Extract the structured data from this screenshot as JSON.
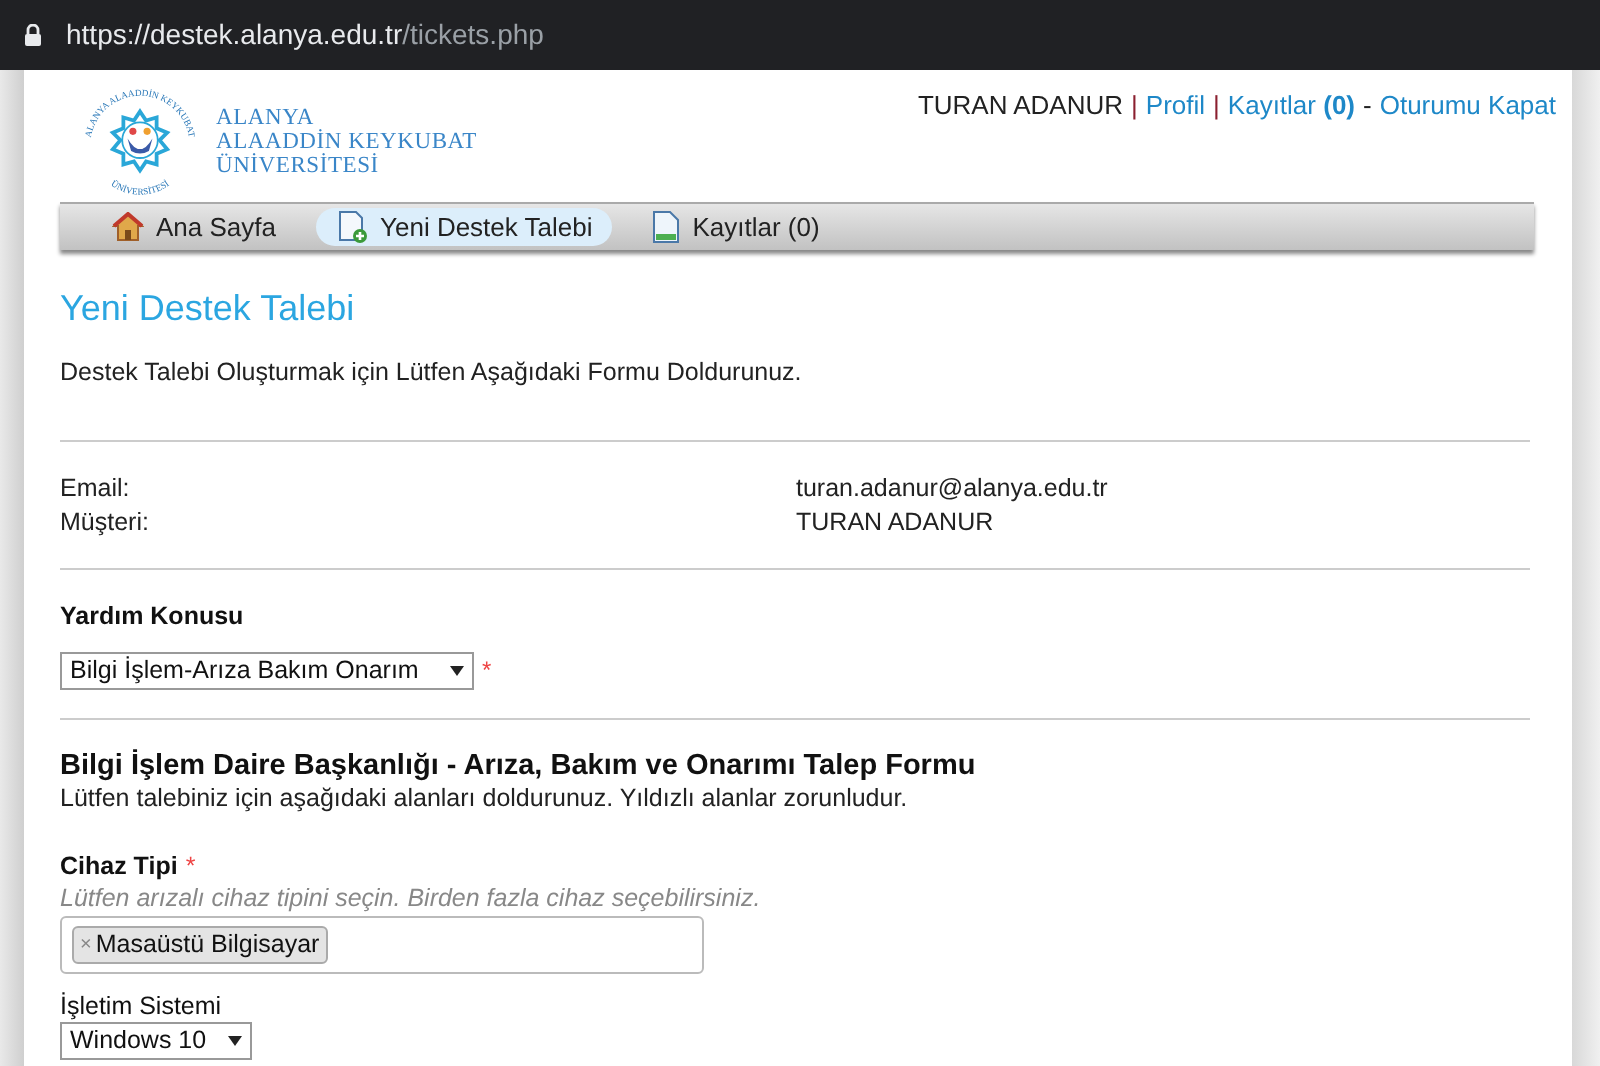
{
  "browser": {
    "url_host": "https://destek.alanya.edu.tr",
    "url_path": "/tickets.php"
  },
  "logo": {
    "arc_top": "ALANYA ALAADDİN KEYKUBAT",
    "arc_bottom": "ÜNİVERSİTESİ",
    "lines": [
      "ALANYA",
      "ALAADDİN KEYKUBAT",
      "ÜNİVERSİTESİ"
    ]
  },
  "user_bar": {
    "user": "TURAN ADANUR",
    "separator_1": "|",
    "profile": "Profil",
    "separator_2": "|",
    "records": "Kayıtlar **(0)**",
    "separator_3": "-",
    "logout": "Oturumu Kapat"
  },
  "nav": [
    {
      "label": "Ana Sayfa",
      "selected": false
    },
    {
      "label": "Yeni Destek Talebi",
      "selected": true
    },
    {
      "label": "Kayıtlar (0)",
      "selected": false
    }
  ],
  "title": "Yeni Destek Talebi",
  "intro": "Destek Talebi Oluşturmak için Lütfen Aşağıdaki Formu Doldurunuz.",
  "info": [
    {
      "label": "Email:",
      "value": "turan.adanur@alanya.edu.tr"
    },
    {
      "label": "Müşteri:",
      "value": "TURAN ADANUR"
    }
  ],
  "help_topic": {
    "label": "Yardım Konusu",
    "value": "Bilgi İşlem-Arıza Bakım Onarım",
    "required_mark": "*"
  },
  "form": {
    "heading": "Bilgi İşlem Daire Başkanlığı - Arıza, Bakım ve Onarımı Talep Formu",
    "note": "Lütfen talebiniz için aşağıdaki alanları doldurunuz. Yıldızlı alanlar zorunludur.",
    "device_type": {
      "label": "Cihaz Tipi",
      "required_mark": "*",
      "hint": "Lütfen arızalı cihaz tipini seçin. Birden fazla cihaz seçebilirsiniz.",
      "tags": [
        {
          "remove": "×",
          "label": "Masaüstü Bilgisayar"
        }
      ]
    },
    "os": {
      "label": "İşletim Sistemi",
      "value": "Windows 10"
    }
  }
}
